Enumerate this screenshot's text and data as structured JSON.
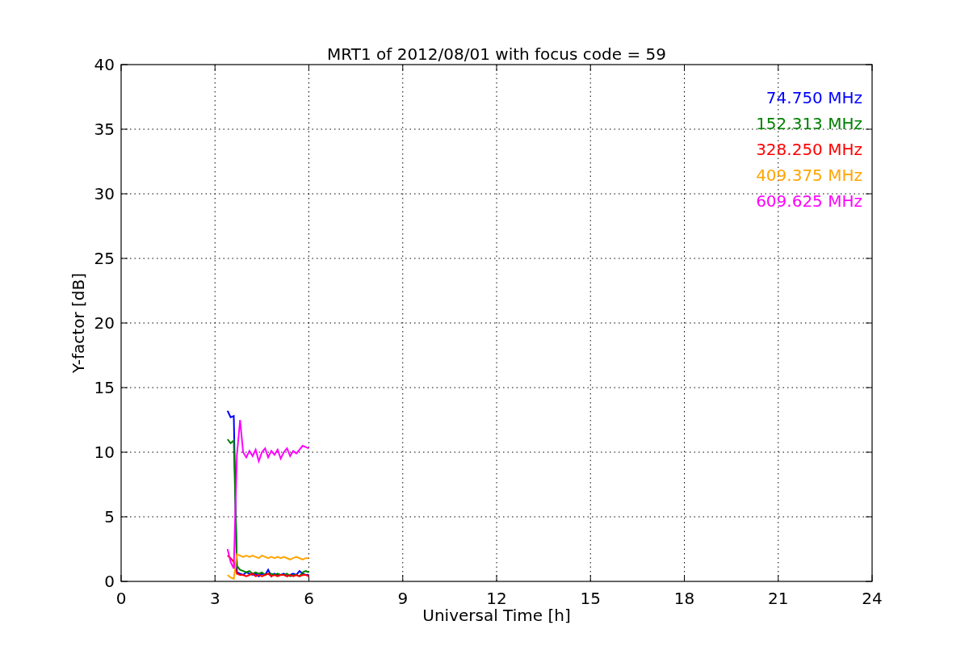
{
  "figure": {
    "chart_data": {
      "type": "line",
      "title": "MRT1 of 2012/08/01 with focus code = 59",
      "xlabel": "Universal Time [h]",
      "ylabel": "Y-factor [dB]",
      "x": [
        3.4,
        3.5,
        3.6,
        3.7,
        3.8,
        3.9,
        4.0,
        4.1,
        4.2,
        4.3,
        4.4,
        4.5,
        4.6,
        4.7,
        4.8,
        4.9,
        5.0,
        5.1,
        5.2,
        5.3,
        5.4,
        5.5,
        5.6,
        5.7,
        5.8,
        5.9,
        6.0
      ],
      "series": [
        {
          "name": "74.750 MHz",
          "color": "#0000ff",
          "values": [
            13.2,
            12.7,
            12.8,
            0.7,
            0.6,
            0.5,
            0.7,
            0.6,
            0.5,
            0.6,
            0.4,
            0.6,
            0.5,
            0.9,
            0.4,
            0.6,
            0.5,
            0.5,
            0.6,
            0.4,
            0.5,
            0.6,
            0.5,
            0.8,
            0.6,
            0.5,
            0.5
          ]
        },
        {
          "name": "152.313 MHz",
          "color": "#008000",
          "values": [
            11.0,
            10.7,
            10.9,
            1.2,
            0.9,
            0.8,
            0.7,
            0.8,
            0.6,
            0.7,
            0.6,
            0.7,
            0.5,
            0.6,
            0.6,
            0.5,
            0.6,
            0.5,
            0.5,
            0.6,
            0.4,
            0.5,
            0.5,
            0.4,
            0.7,
            0.8,
            0.7
          ]
        },
        {
          "name": "328.250 MHz",
          "color": "#ff0000",
          "values": [
            2.0,
            1.8,
            1.5,
            0.6,
            0.5,
            0.5,
            0.4,
            0.5,
            0.6,
            0.4,
            0.5,
            0.4,
            0.5,
            0.6,
            0.4,
            0.5,
            0.4,
            0.5,
            0.5,
            0.4,
            0.5,
            0.4,
            0.5,
            0.4,
            0.5,
            0.5,
            0.4
          ]
        },
        {
          "name": "409.375 MHz",
          "color": "#ffa500",
          "values": [
            0.5,
            0.3,
            0.2,
            2.1,
            2.0,
            1.9,
            2.0,
            1.9,
            2.0,
            1.9,
            1.8,
            2.0,
            1.9,
            1.8,
            1.9,
            1.8,
            1.9,
            1.8,
            1.9,
            1.8,
            1.7,
            1.8,
            1.9,
            1.8,
            1.7,
            1.8,
            1.8
          ]
        },
        {
          "name": "609.625 MHz",
          "color": "#ff00ff",
          "values": [
            2.5,
            1.5,
            1.0,
            9.8,
            12.5,
            10.0,
            9.6,
            10.1,
            9.7,
            10.2,
            9.3,
            10.0,
            10.3,
            9.6,
            10.1,
            9.8,
            10.2,
            9.5,
            10.0,
            10.3,
            9.7,
            10.1,
            9.9,
            10.2,
            10.5,
            10.4,
            10.3
          ]
        }
      ],
      "xlim": [
        0,
        24
      ],
      "ylim": [
        0,
        40
      ],
      "xticks": [
        0,
        3,
        6,
        9,
        12,
        15,
        18,
        21,
        24
      ],
      "yticks": [
        0,
        5,
        10,
        15,
        20,
        25,
        30,
        35,
        40
      ],
      "grid": true
    }
  }
}
